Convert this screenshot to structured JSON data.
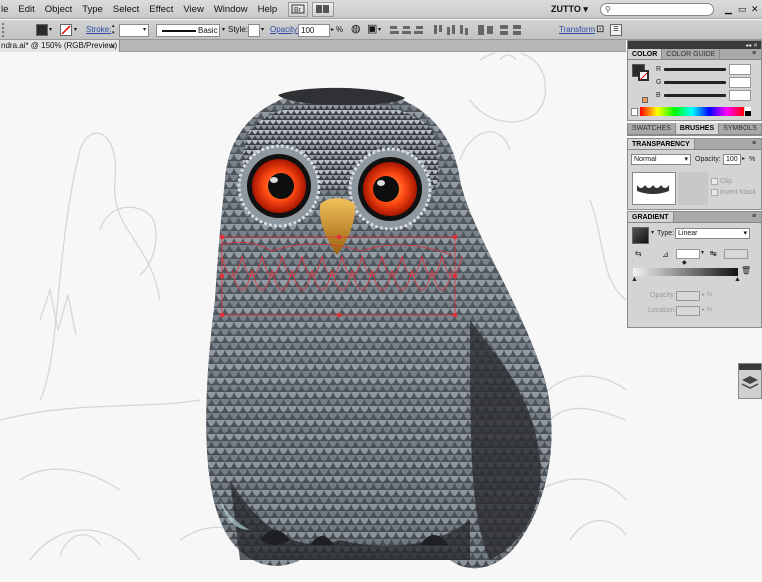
{
  "menu": {
    "items": [
      "le",
      "Edit",
      "Object",
      "Type",
      "Select",
      "Effect",
      "View",
      "Window",
      "Help"
    ]
  },
  "workspace": {
    "name": "ZUTTO",
    "search_placeholder": ""
  },
  "control_bar": {
    "stroke_label": "Stroke:",
    "brush_name": "Basic",
    "style_label": "Style:",
    "opacity_label": "Opacity:",
    "opacity_value": "100",
    "opacity_unit": "%",
    "transform_label": "Transform"
  },
  "document_tab": {
    "title": "ndra.ai* @ 150% (RGB/Preview)",
    "close_glyph": "×"
  },
  "color_panel": {
    "tabs": [
      "COLOR",
      "COLOR GUIDE"
    ],
    "channels": [
      "R",
      "G",
      "B"
    ]
  },
  "swatches_panel": {
    "tabs": [
      "SWATCHES",
      "BRUSHES",
      "SYMBOLS"
    ]
  },
  "transparency_panel": {
    "title": "TRANSPARENCY",
    "blend_mode": "Normal",
    "opacity_label": "Opacity:",
    "opacity_value": "100",
    "opacity_unit": "%",
    "clip_label": "Clip",
    "invert_label": "Invert Mask"
  },
  "gradient_panel": {
    "title": "GRADIENT",
    "type_label": "Type:",
    "type_value": "Linear",
    "opacity_label": "Opacity:",
    "location_label": "Location:"
  },
  "colors": {
    "owl_dark": "#2e2e30",
    "owl_feather": "#6f767d",
    "owl_light": "#c9ced3",
    "eye_iris": "#e8401a",
    "beak": "#c88a1f",
    "selection": "#e0303a",
    "sketch_line": "#d6d6d6"
  }
}
